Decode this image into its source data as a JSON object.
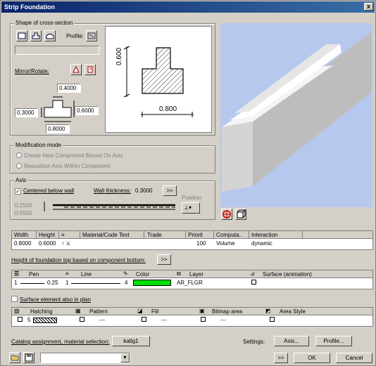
{
  "window": {
    "title": "Strip Foundation",
    "close": "x"
  },
  "shape": {
    "group_label": "Shape of cross-section",
    "profile_label": "Profile:",
    "mirror_label": "Mirror/Rotate:",
    "dims": {
      "top": "0.4000",
      "left": "0.3000",
      "right": "0.6000",
      "bottom": "0.8000"
    },
    "preview_height": "0.600",
    "preview_width": "0.800"
  },
  "modification": {
    "group_label": "Modification mode",
    "opt1": "Create New Component Based On Axis",
    "opt2": "Reposition Axis Within Component"
  },
  "axis": {
    "group_label": "Axis",
    "centered": "Centered below wall",
    "wall_label": "Wall thickness:",
    "wall_value": "0.3000",
    "position_label": "Position",
    "val1": "0.2500",
    "val2": "0.5500",
    "more": ">>"
  },
  "main_table": {
    "headers": [
      "Width",
      "Height",
      "≡",
      "Material/Code Text",
      "Trade",
      "Priorit",
      "Computa..",
      "Interaction"
    ],
    "row": [
      "0.8000",
      "0.6000",
      "↑ ⚔",
      "",
      "",
      "100",
      "Volume",
      "dynamic"
    ]
  },
  "height_label": "Height of foundation top based on component bottom:",
  "pen_table": {
    "headers": [
      "Pen",
      "Line",
      "Color",
      "Layer",
      "Surface (animation)"
    ],
    "row": {
      "pen": "1",
      "pen_width": "0.25",
      "line": "1",
      "color": "4",
      "color_hex": "#00dd00",
      "layer": "AR_FLGR"
    }
  },
  "surface_label": "Surface element also in plan",
  "hatch_table": {
    "headers": [
      "Hatching",
      "Pattern",
      "Fill",
      "Bitmap area",
      "Area Style"
    ],
    "row": {
      "hatch_num": "5",
      "pattern": "---",
      "fill": "---",
      "bitmap": "---"
    }
  },
  "catalog": {
    "label": "Catalog assignment, material selection:",
    "button": "katlg1"
  },
  "settings": {
    "label": "Settings:",
    "axis": "Axis...",
    "profile": "Profile..."
  },
  "footer": {
    "more": ">>",
    "ok": "OK",
    "cancel": "Cancel"
  }
}
